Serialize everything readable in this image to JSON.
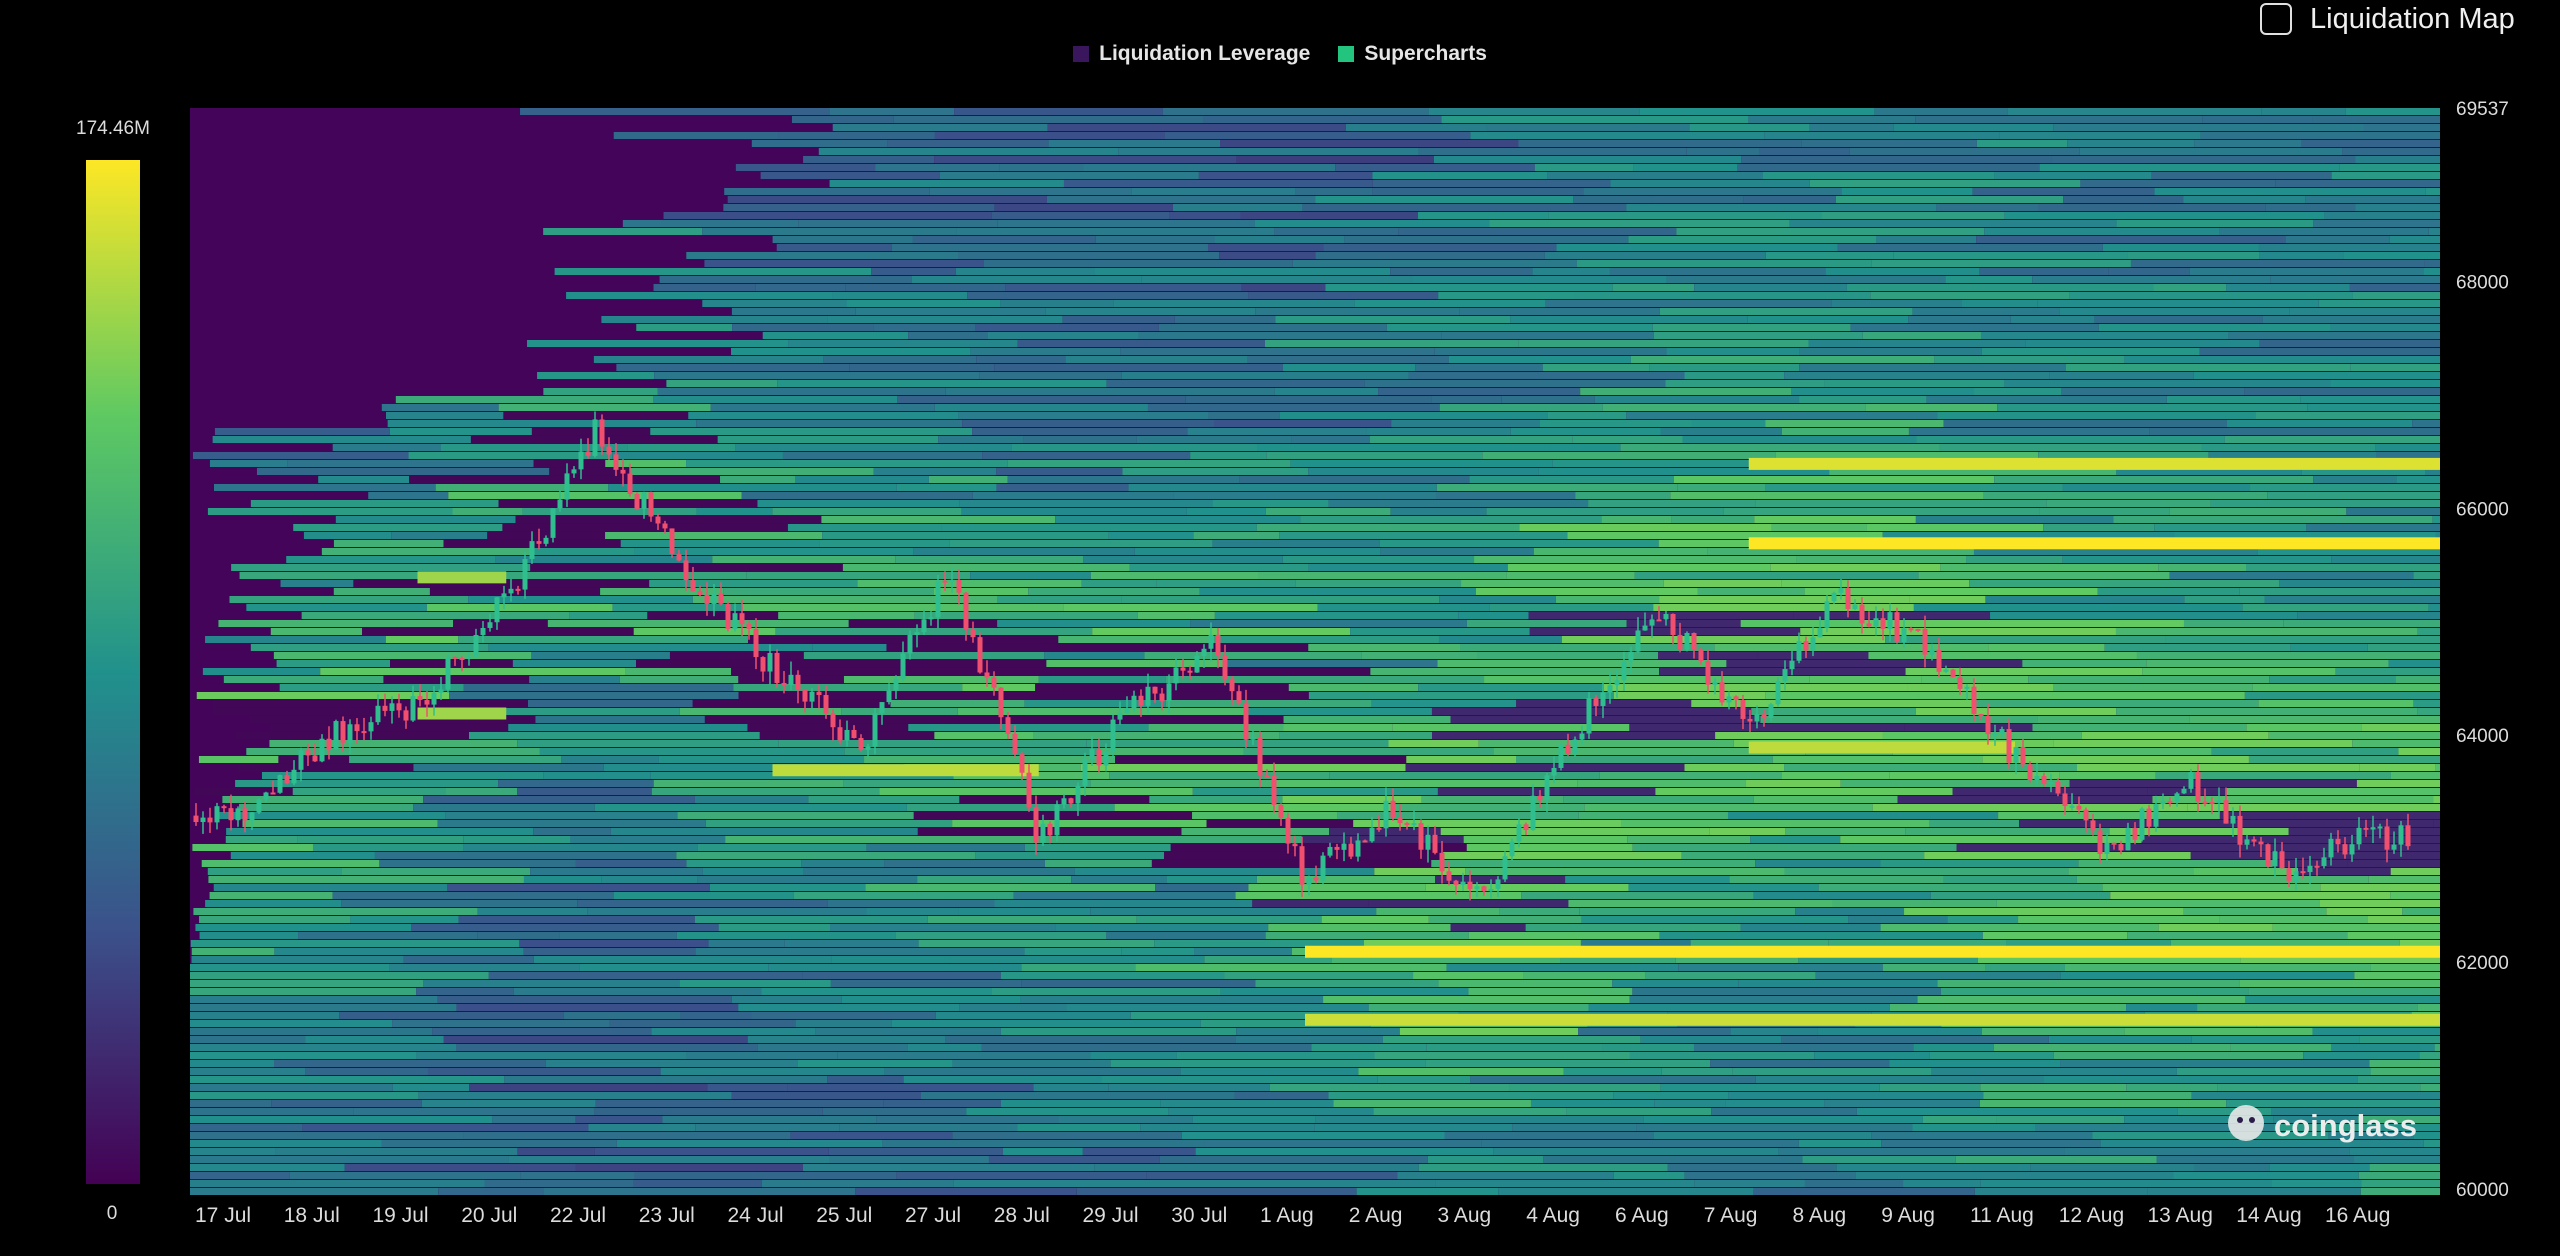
{
  "toggle": {
    "label": "Liquidation Map",
    "checked": false
  },
  "legend": [
    {
      "label": "Liquidation Leverage",
      "color": "#3a175c"
    },
    {
      "label": "Supercharts",
      "color": "#22c47e"
    }
  ],
  "colorbar": {
    "max_label": "174.46M",
    "min_label": "0",
    "max": 174.46,
    "min": 0,
    "unit": "M"
  },
  "watermark": "coinglass",
  "chart_data": {
    "type": "heatmap",
    "title": "",
    "x_labels": [
      "17 Jul",
      "18 Jul",
      "19 Jul",
      "20 Jul",
      "22 Jul",
      "23 Jul",
      "24 Jul",
      "25 Jul",
      "27 Jul",
      "28 Jul",
      "29 Jul",
      "30 Jul",
      "1 Aug",
      "2 Aug",
      "3 Aug",
      "4 Aug",
      "6 Aug",
      "7 Aug",
      "8 Aug",
      "9 Aug",
      "11 Aug",
      "12 Aug",
      "13 Aug",
      "14 Aug",
      "16 Aug"
    ],
    "y_ticks": [
      60000,
      62000,
      64000,
      66000,
      68000
    ],
    "y_top_label": "69537",
    "ylim": [
      60000,
      69537
    ],
    "colorscale": [
      "#440154",
      "#3b528b",
      "#21918c",
      "#5ec962",
      "#fde725"
    ],
    "series": [
      {
        "name": "Price",
        "type": "candlestick",
        "values": [
          63300,
          64000,
          64300,
          65200,
          66700,
          65500,
          64600,
          63900,
          65500,
          63100,
          64200,
          64800,
          62700,
          63400,
          62500,
          64000,
          65100,
          64100,
          65200,
          64800,
          63800,
          63000,
          63600,
          62800,
          63100
        ]
      }
    ],
    "bands": [
      {
        "y": 62100,
        "intensity": 1.0,
        "from": "1 Aug",
        "to": "16 Aug"
      },
      {
        "y": 61500,
        "intensity": 0.92,
        "from": "1 Aug",
        "to": "16 Aug"
      },
      {
        "y": 65700,
        "intensity": 1.0,
        "from": "7 Aug",
        "to": "16 Aug"
      },
      {
        "y": 66400,
        "intensity": 0.95,
        "from": "7 Aug",
        "to": "16 Aug"
      },
      {
        "y": 63900,
        "intensity": 0.9,
        "from": "7 Aug",
        "to": "11 Aug"
      },
      {
        "y": 63700,
        "intensity": 0.9,
        "from": "24 Jul",
        "to": "28 Jul"
      },
      {
        "y": 64200,
        "intensity": 0.85,
        "from": "19 Jul",
        "to": "20 Jul"
      },
      {
        "y": 65400,
        "intensity": 0.85,
        "from": "19 Jul",
        "to": "20 Jul"
      }
    ]
  }
}
